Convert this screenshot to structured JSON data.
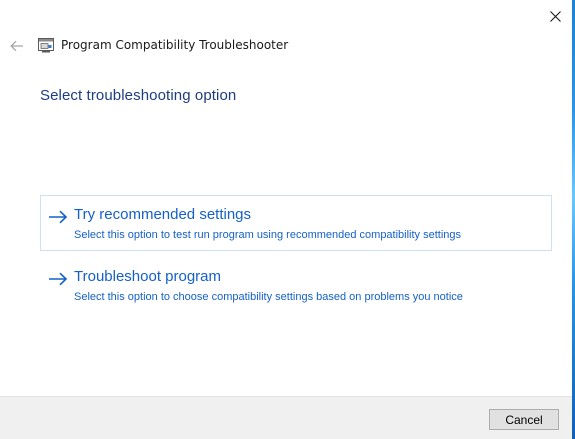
{
  "window": {
    "title": "Program Compatibility Troubleshooter",
    "close_icon": "close-icon",
    "back_icon": "back-arrow-icon",
    "app_icon": "troubleshooter-app-icon"
  },
  "main": {
    "title": "Select troubleshooting option",
    "options": [
      {
        "title": "Try recommended settings",
        "description": "Select this option to test run program using recommended compatibility settings",
        "icon": "arrow-right-icon",
        "focused": true
      },
      {
        "title": "Troubleshoot program",
        "description": "Select this option to choose compatibility settings based on problems you notice",
        "icon": "arrow-right-icon",
        "focused": false
      }
    ]
  },
  "footer": {
    "cancel_label": "Cancel"
  },
  "colors": {
    "link_blue": "#1560c8",
    "title_blue": "#1e3c80",
    "footer_bg": "#f0f0f0"
  }
}
